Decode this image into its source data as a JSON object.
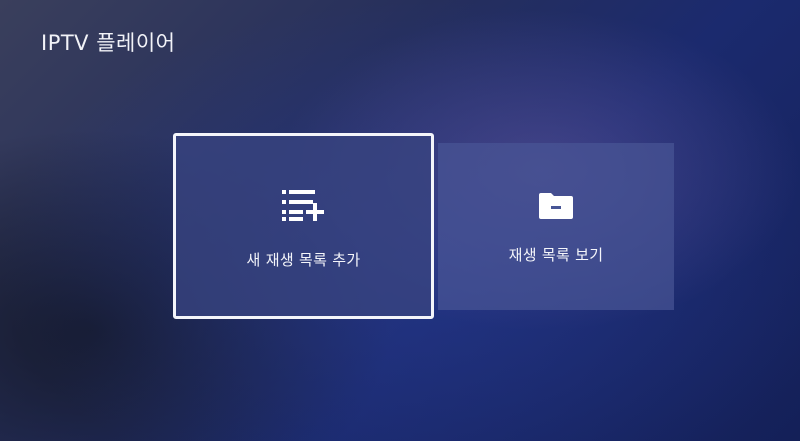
{
  "header": {
    "title": "IPTV 플레이어"
  },
  "tiles": [
    {
      "label": "새 재생 목록 추가",
      "icon": "playlist-add-icon",
      "focused": true
    },
    {
      "label": "재생 목록 보기",
      "icon": "folder-icon",
      "focused": false
    }
  ],
  "colors": {
    "focus_border": "#f4f5fa",
    "tile_focused_bg": "#384480",
    "tile_bg": "#485696",
    "background": "#1b2a6e"
  }
}
